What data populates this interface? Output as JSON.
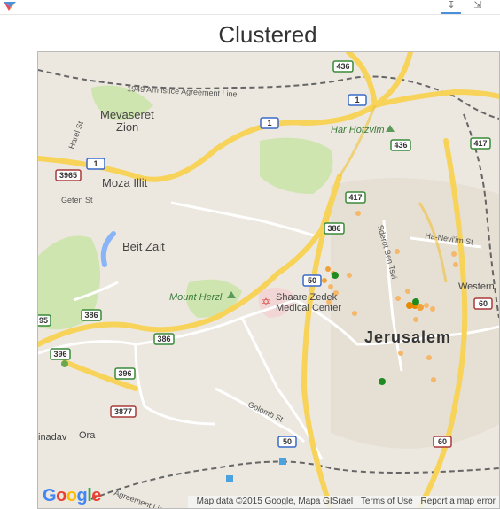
{
  "toolbar": {
    "download_icon": "download-icon",
    "expand_icon": "expand-icon"
  },
  "title": "Clustered",
  "map": {
    "places": {
      "mevaseret": "Mevaseret",
      "zion": "Zion",
      "moza": "Moza Illit",
      "beit_zait": "Beit Zait",
      "har_hotzvim": "Har Hotzvim",
      "mount_herzl": "Mount Herzl",
      "shaare1": "Shaare Zedek",
      "shaare2": "Medical Center",
      "jerusalem": "Jerusalem",
      "western": "Western",
      "ora": "Ora",
      "inadav": "inadav"
    },
    "streets": {
      "armistice": "1949 Armistice Agreement Line",
      "agreement_bottom": "Agreement Line",
      "harel": "Harel St",
      "geten": "Geten St",
      "sderot": "Sderot Ben Tsvi",
      "ha_neviim": "Ha-Nevi'im St",
      "golomb": "Golomb St"
    },
    "road_shields": {
      "r436a": "436",
      "r1a": "1",
      "r1b": "1",
      "r1c": "1",
      "r436b": "436",
      "r417a": "417",
      "r3965": "3965",
      "r417b": "417",
      "r386a": "386",
      "r50a": "50",
      "r60a": "60",
      "r95": "95",
      "r386b": "386",
      "r386c": "386",
      "r396a": "396",
      "r396b": "396",
      "r3877": "3877",
      "r50b": "50",
      "r60b": "60"
    },
    "attribution": {
      "data": "Map data ©2015 Google, Mapa GISrael",
      "terms": "Terms of Use",
      "report": "Report a map error"
    },
    "logo": [
      "G",
      "o",
      "o",
      "g",
      "l",
      "e"
    ],
    "colors": {
      "cluster_small": "#f5b76a",
      "cluster_medium": "#f0a23a",
      "cluster_large": "#e58a00",
      "single_marker": "#1f8a1f",
      "green_marker": "#6aa84f",
      "highway": "#f7d35a",
      "park": "#cfe5b0"
    }
  }
}
